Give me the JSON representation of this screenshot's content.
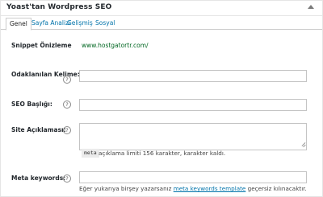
{
  "metabox": {
    "title": "Yoast'tan Wordpress SEO"
  },
  "tabs": [
    {
      "label": "Genel",
      "active": true
    },
    {
      "label": "Sayfa Analizi",
      "active": false
    },
    {
      "label": "Gelişmiş",
      "active": false
    },
    {
      "label": "Sosyal",
      "active": false
    }
  ],
  "fields": {
    "snippet": {
      "label": "Snippet Önizleme",
      "url": "www.hostgatortr.com/"
    },
    "focus_keyword": {
      "label": "Odaklanılan Kelime:",
      "value": "",
      "help": "?"
    },
    "seo_title": {
      "label": "SEO Başlığı:",
      "value": "",
      "help": "?"
    },
    "meta_description": {
      "label": "Site Açıklaması:",
      "value": "",
      "help": "?",
      "code_tag": "meta",
      "note": "açıklama limiti 156 karakter, karakter kaldı."
    },
    "meta_keywords": {
      "label": "Meta keywords:",
      "value": "",
      "help": "?",
      "note_before": "Eğer yukarıya birşey yazarsanız ",
      "note_link": "meta keywords template",
      "note_after": " geçersiz kılınacaktır."
    }
  },
  "colors": {
    "link": "#0073aa",
    "url_green": "#006621",
    "border": "#c4c4c4"
  }
}
